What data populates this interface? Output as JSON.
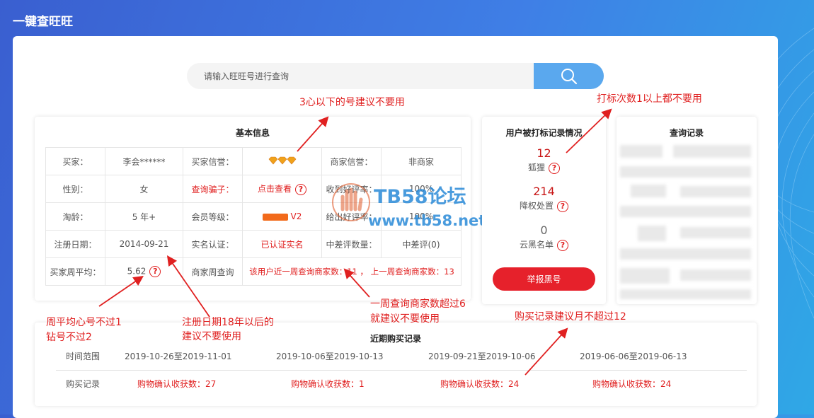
{
  "app": {
    "title": "一键查旺旺"
  },
  "search": {
    "placeholder": "请输入旺旺号进行查询",
    "icon": "search-icon"
  },
  "basic_info": {
    "title": "基本信息",
    "rows": [
      [
        {
          "text": "买家："
        },
        {
          "text": "李会******"
        },
        {
          "text": "买家信誉："
        },
        {
          "text": "",
          "icon": "diamond-icon"
        },
        {
          "text": "商家信誉："
        },
        {
          "text": "非商家"
        }
      ],
      [
        {
          "text": "性别："
        },
        {
          "text": "女"
        },
        {
          "text": "查询骗子："
        },
        {
          "text": "点击查看"
        },
        {
          "text": "收到好评率："
        },
        {
          "text": "100%"
        }
      ],
      [
        {
          "text": "淘龄："
        },
        {
          "text": "5 年+"
        },
        {
          "text": "会员等级："
        },
        {
          "text": "V2"
        },
        {
          "text": "给出好评率："
        },
        {
          "text": "100%"
        }
      ],
      [
        {
          "text": "注册日期："
        },
        {
          "text": "2014-09-21"
        },
        {
          "text": "实名认证："
        },
        {
          "text": "已认证实名"
        },
        {
          "text": "中差评数量："
        },
        {
          "text": "中差评(0)"
        }
      ],
      [
        {
          "text": "买家周平均："
        },
        {
          "text": "5.62"
        },
        {
          "text": "商家周查询"
        },
        {
          "text": "该用户近一周查询商家数：11 ， 上一周查询商家数：13"
        }
      ]
    ]
  },
  "marks": {
    "title": "用户被打标记录情况",
    "items": [
      {
        "value": "12",
        "label": "狐狸"
      },
      {
        "value": "214",
        "label": "降权处置"
      },
      {
        "value": "0",
        "label": "云黑名单"
      }
    ],
    "report_button": "举报黑号"
  },
  "history": {
    "title": "查询记录"
  },
  "recent": {
    "title": "近期购买记录",
    "range_label": "时间范围",
    "records_label": "购买记录",
    "ranges": [
      "2019-10-26至2019-11-01",
      "2019-10-06至2019-10-13",
      "2019-09-21至2019-10-06",
      "2019-06-06至2019-06-13"
    ],
    "records": [
      "购物确认收获数：27",
      "购物确认收获数：1",
      "购物确认收获数：24",
      "购物确认收获数：24"
    ]
  },
  "annotations": [
    "3心以下的号建议不要用",
    "打标次数1以上都不要用",
    "周平均心号不过1",
    "钻号不过2",
    "注册日期18年以后的",
    "建议不要使用",
    "一周查询商家数超过6",
    "就建议不要使用",
    "购买记录建议月不超过12"
  ],
  "watermark": {
    "line1": "TB58论坛",
    "line2": "www.tb58.net"
  },
  "colors": {
    "accent": "#5aa8ee",
    "danger": "#e6212b",
    "annotation": "#e02020"
  }
}
